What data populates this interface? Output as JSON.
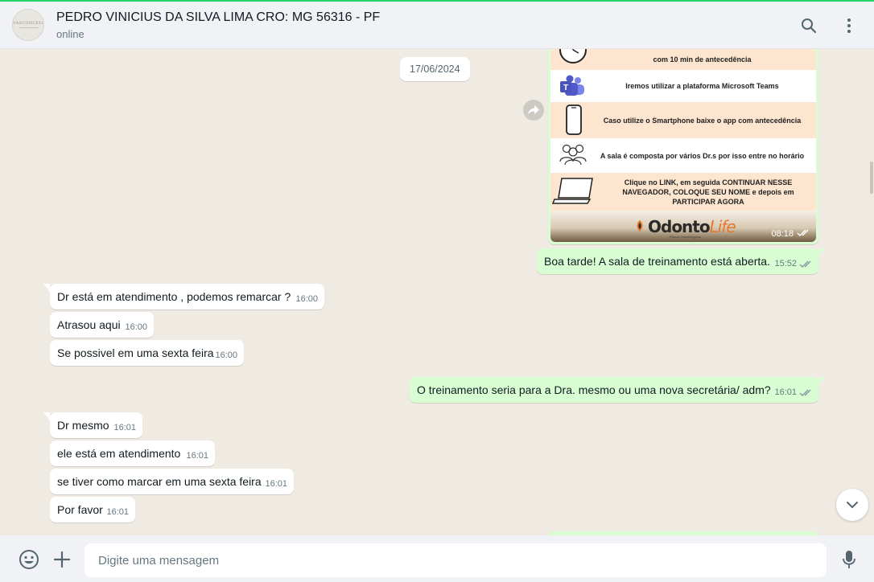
{
  "header": {
    "contact_name": "PEDRO VINICIUS DA SILVA LIMA CRO: MG 56316 - PF",
    "status": "online",
    "avatar_text": "VASCONCELOS",
    "icons": [
      "search-icon",
      "menu-icon"
    ]
  },
  "chat": {
    "date_divider": "17/06/2024",
    "image_message": {
      "rows": [
        {
          "icon": "clock-icon",
          "text": "com 10 min de antecedência"
        },
        {
          "icon": "teams-icon",
          "text": "Iremos utilizar a plataforma Microsoft Teams"
        },
        {
          "icon": "smartphone-icon",
          "text": "Caso utilize o Smartphone baixe o app com antecedência"
        },
        {
          "icon": "group-icon",
          "text": "A sala é composta por vários Dr.s por isso entre no horário"
        },
        {
          "icon": "laptop-icon",
          "text": "Clique no LINK, em seguida CONTINUAR NESSE NAVEGADOR, COLOQUE SEU NOME e depois em PARTICIPAR AGORA"
        }
      ],
      "logo_main": "Odonto",
      "logo_accent": "Life",
      "logo_sub": "Planos Odontológicos",
      "time": "08:18"
    },
    "messages": [
      {
        "direction": "out",
        "text": "Boa tarde! A sala de treinamento está aberta.",
        "time": "15:52"
      },
      {
        "direction": "in",
        "text": "Dr está em atendimento , podemos remarcar ?",
        "time": "16:00"
      },
      {
        "direction": "in",
        "text": "Atrasou aqui",
        "time": "16:00"
      },
      {
        "direction": "in",
        "text": "Se possivel em uma sexta feira",
        "time": "16:00"
      },
      {
        "direction": "out",
        "text": "O treinamento seria para a Dra. mesmo ou uma nova secretária/ adm?",
        "time": "16:01"
      },
      {
        "direction": "in",
        "text": "Dr mesmo",
        "time": "16:01"
      },
      {
        "direction": "in",
        "text": "ele está em atendimento",
        "time": "16:01"
      },
      {
        "direction": "in",
        "text": "se tiver como marcar em uma sexta feira",
        "time": "16:01"
      },
      {
        "direction": "in",
        "text": "Por favor",
        "time": "16:01"
      }
    ]
  },
  "composer": {
    "placeholder": "Digite uma mensagem",
    "value": ""
  },
  "colors": {
    "chat_bg": "#efeae2",
    "incoming_bubble": "#ffffff",
    "outgoing_bubble": "#d9fdd3",
    "read_ticks": "#53bdeb",
    "header_bg": "#f0f2f5"
  }
}
